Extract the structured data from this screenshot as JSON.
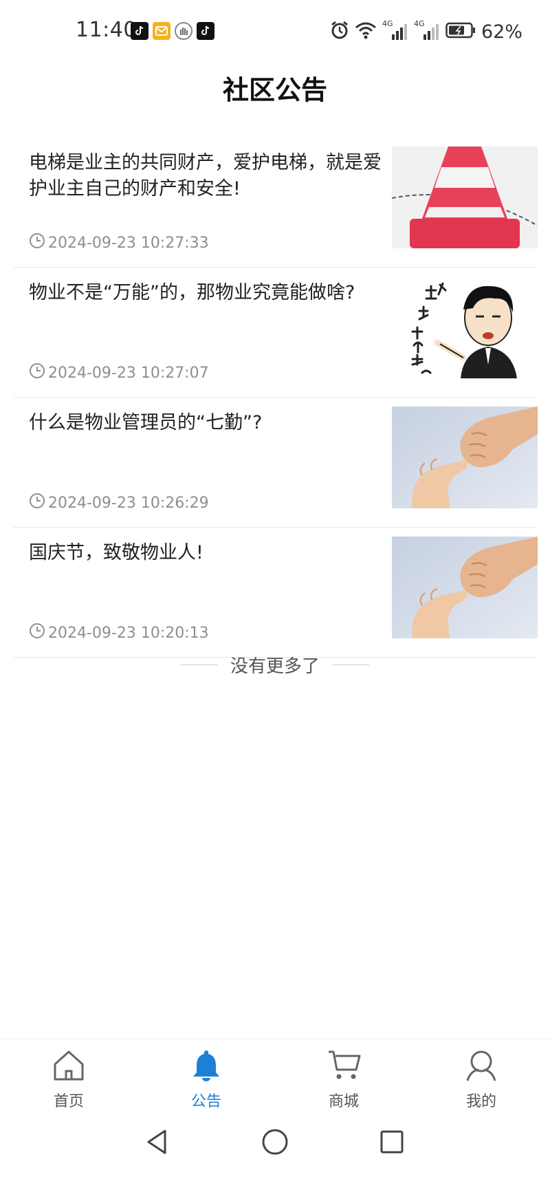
{
  "status_bar": {
    "time": "11:40",
    "notification_icons": [
      "tiktok-icon",
      "mail-icon",
      "hand-icon",
      "tiktok-icon"
    ],
    "network_1": "4G",
    "network_2": "4G",
    "battery": "62%"
  },
  "header": {
    "title": "社区公告"
  },
  "notices": [
    {
      "title": "电梯是业主的共同财产，爱护电梯，就是爱护业主自己的财产和安全!",
      "time": "2024-09-23 10:27:33",
      "thumb": "traffic-cone-image"
    },
    {
      "title": "物业不是“万能”的，那物业究竟能做啥?",
      "time": "2024-09-23 10:27:07",
      "thumb": "meme-cartoon-image"
    },
    {
      "title": "什么是物业管理员的“七勤”?",
      "time": "2024-09-23 10:26:29",
      "thumb": "pinky-promise-image"
    },
    {
      "title": "国庆节，致敬物业人!",
      "time": "2024-09-23 10:20:13",
      "thumb": "pinky-promise-image"
    }
  ],
  "list_end": {
    "text": "没有更多了"
  },
  "bottom_nav": {
    "tabs": [
      {
        "label": "首页",
        "icon": "home-icon"
      },
      {
        "label": "公告",
        "icon": "bell-icon"
      },
      {
        "label": "商城",
        "icon": "cart-icon"
      },
      {
        "label": "我的",
        "icon": "user-icon"
      }
    ],
    "active_tab": "公告"
  },
  "colors": {
    "accent": "#1e7fd6",
    "text_primary": "#222222",
    "text_secondary": "#8e8e8e"
  }
}
